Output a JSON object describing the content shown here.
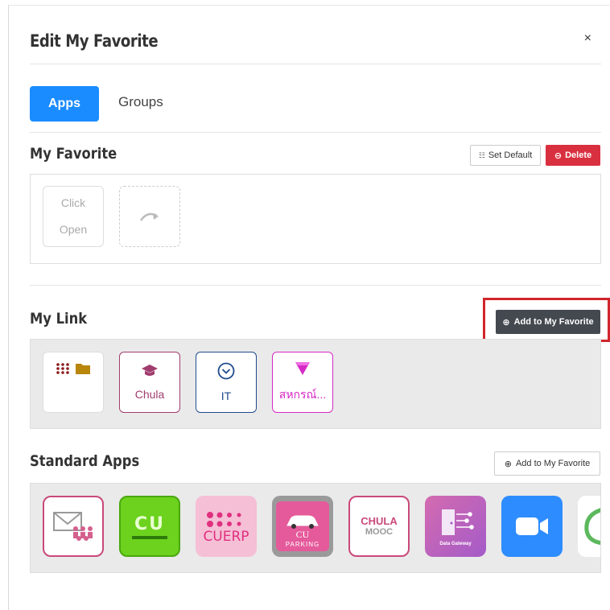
{
  "modal": {
    "title": "Edit My Favorite",
    "close_label": "×"
  },
  "tabs": [
    {
      "label": "Apps",
      "active": true
    },
    {
      "label": "Groups",
      "active": false
    }
  ],
  "my_favorite": {
    "title": "My Favorite",
    "set_default_label": "Set Default",
    "delete_label": "Delete",
    "click_open_tile": {
      "line1": "Click",
      "line2": "Open"
    }
  },
  "my_link": {
    "title": "My Link",
    "add_button_label": "Add to My Favorite",
    "tiles": [
      {
        "label": "",
        "icon": "apps-grid-folder-icon"
      },
      {
        "label": "Chula",
        "icon": "graduation-cap-icon",
        "color": "#a03c6e"
      },
      {
        "label": "IT",
        "icon": "chevron-circle-icon",
        "color": "#1e4b8c"
      },
      {
        "label": "สหกรณ์...",
        "icon": "pink-gem-icon",
        "color": "#d62ac6"
      }
    ]
  },
  "standard_apps": {
    "title": "Standard Apps",
    "add_button_label": "Add to My Favorite",
    "apps": [
      {
        "name": "mail-people-app-icon"
      },
      {
        "name": "cu-logo-app-icon",
        "text": "CU"
      },
      {
        "name": "cuerp-app-icon",
        "text": "CUERP"
      },
      {
        "name": "cu-parking-app-icon",
        "text": "CU",
        "subtext": "PARKING"
      },
      {
        "name": "chula-mooc-app-icon",
        "text": "CHULA",
        "subtext": "MOOC"
      },
      {
        "name": "data-gateway-app-icon",
        "text": "Data Gateway"
      },
      {
        "name": "zoom-app-icon"
      },
      {
        "name": "partial-app-icon"
      }
    ]
  },
  "colors": {
    "primary": "#1a8cff",
    "danger": "#d9303f",
    "dark_button": "#444950",
    "highlight": "#d0262b"
  }
}
